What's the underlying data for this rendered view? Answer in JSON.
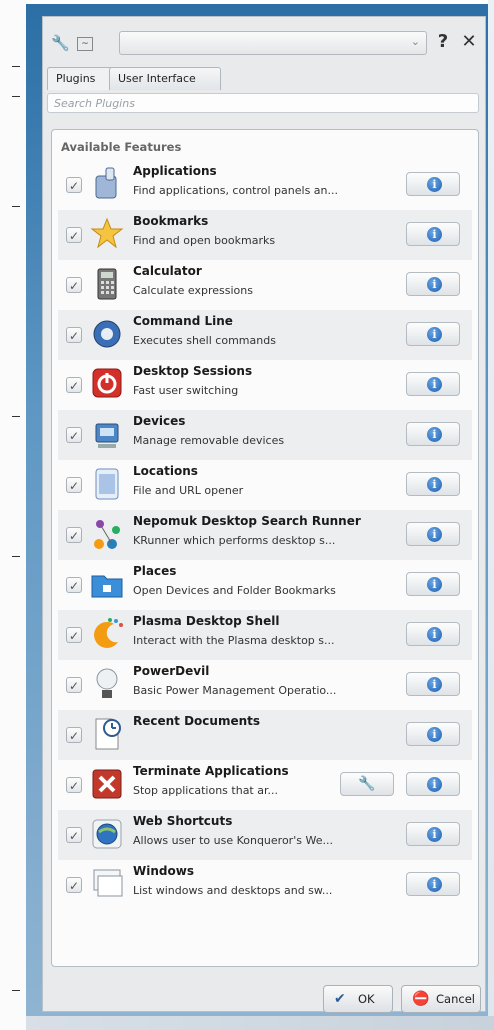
{
  "toolbar": {
    "left_icons": [
      "wrench-icon",
      "widget-icon"
    ],
    "help_label": "?",
    "close_label": "✕"
  },
  "tabs": [
    {
      "label": "Plugins",
      "mnemonic": "P",
      "active": true
    },
    {
      "label": "User Interface",
      "mnemonic": "U",
      "active": false
    }
  ],
  "search": {
    "placeholder": "Search Plugins"
  },
  "group": {
    "title": "Available Features"
  },
  "features": [
    {
      "name": "Applications",
      "description": "Find applications, control panels an...",
      "icon": "applications-icon",
      "checked": true,
      "configurable": false
    },
    {
      "name": "Bookmarks",
      "description": "Find and open bookmarks",
      "icon": "bookmarks-star-icon",
      "checked": true,
      "configurable": false
    },
    {
      "name": "Calculator",
      "description": "Calculate expressions",
      "icon": "calculator-icon",
      "checked": true,
      "configurable": false
    },
    {
      "name": "Command Line",
      "description": "Executes shell commands",
      "icon": "command-line-gear-icon",
      "checked": true,
      "configurable": false
    },
    {
      "name": "Desktop Sessions",
      "description": "Fast user switching",
      "icon": "power-button-icon",
      "checked": true,
      "configurable": false
    },
    {
      "name": "Devices",
      "description": "Manage removable devices",
      "icon": "devices-icon",
      "checked": true,
      "configurable": false
    },
    {
      "name": "Locations",
      "description": "File and URL opener",
      "icon": "locations-icon",
      "checked": true,
      "configurable": false
    },
    {
      "name": "Nepomuk Desktop Search Runner",
      "description": "KRunner which performs desktop s...",
      "icon": "nepomuk-icon",
      "checked": true,
      "configurable": false
    },
    {
      "name": "Places",
      "description": "Open Devices and Folder Bookmarks",
      "icon": "places-folder-icon",
      "checked": true,
      "configurable": false
    },
    {
      "name": "Plasma Desktop Shell",
      "description": "Interact with the Plasma desktop s...",
      "icon": "plasma-icon",
      "checked": true,
      "configurable": false
    },
    {
      "name": "PowerDevil",
      "description": "Basic Power Management Operatio...",
      "icon": "lightbulb-icon",
      "checked": true,
      "configurable": false
    },
    {
      "name": "Recent Documents",
      "description": "",
      "icon": "recent-documents-icon",
      "checked": true,
      "configurable": false
    },
    {
      "name": "Terminate Applications",
      "description": "Stop applications that ar...",
      "icon": "terminate-x-icon",
      "checked": true,
      "configurable": true
    },
    {
      "name": "Web Shortcuts",
      "description": "Allows user to use Konqueror's We...",
      "icon": "globe-icon",
      "checked": true,
      "configurable": false
    },
    {
      "name": "Windows",
      "description": "List windows and desktops and sw...",
      "icon": "windows-icon",
      "checked": true,
      "configurable": false
    }
  ],
  "info_label": "i",
  "buttons": {
    "ok_label": "OK",
    "cancel_label": "Cancel"
  },
  "colors": {
    "info_blue": "#1f5fae",
    "window_blue": "#2b6fa6"
  }
}
